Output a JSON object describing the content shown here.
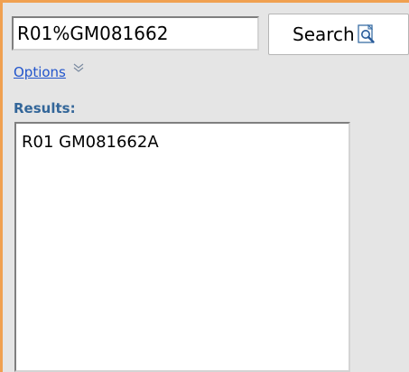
{
  "search": {
    "value": "R01%GM081662",
    "button_label": "Search",
    "button_icon": "magnifier-page-icon"
  },
  "options": {
    "label": "Options",
    "toggle_icon": "double-chevron-down-icon"
  },
  "results": {
    "heading": "Results:",
    "items": [
      "R01 GM081662A"
    ]
  },
  "colors": {
    "panel_background": "#e5e5e5",
    "panel_border": "#f0a050",
    "link": "#2255cc",
    "heading": "#336699"
  }
}
